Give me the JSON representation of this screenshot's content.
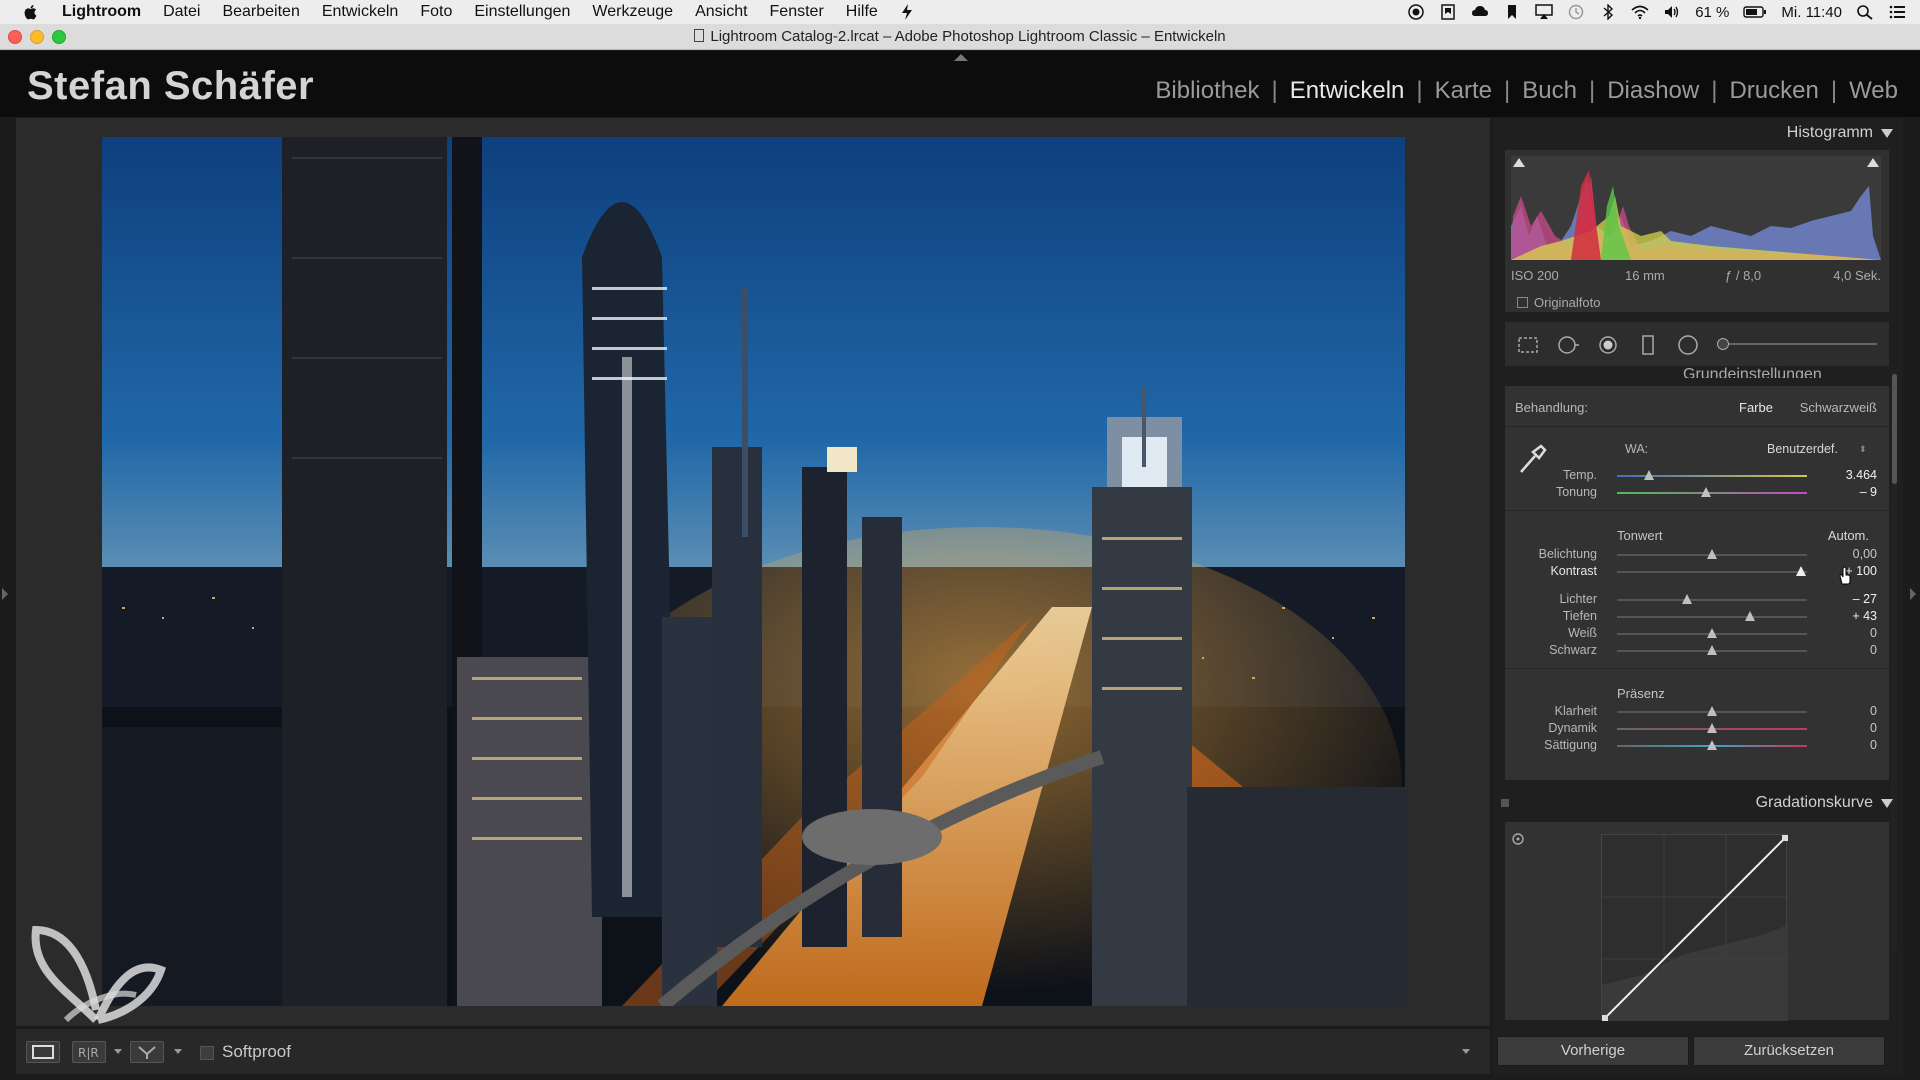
{
  "menubar": {
    "app_name": "Lightroom",
    "items": [
      "Datei",
      "Bearbeiten",
      "Entwickeln",
      "Foto",
      "Einstellungen",
      "Werkzeuge",
      "Ansicht",
      "Fenster",
      "Hilfe"
    ],
    "battery": "61 %",
    "clock": "Mi. 11:40"
  },
  "window": {
    "title": "Lightroom Catalog-2.lrcat – Adobe Photoshop Lightroom Classic – Entwickeln"
  },
  "identity_plate": "Stefan Schäfer",
  "modules": [
    "Bibliothek",
    "Entwickeln",
    "Karte",
    "Buch",
    "Diashow",
    "Drucken",
    "Web"
  ],
  "active_module": "Entwickeln",
  "toolbar": {
    "softproof_label": "Softproof"
  },
  "histogram": {
    "title": "Histogramm",
    "iso": "ISO 200",
    "focal": "16 mm",
    "aperture": "ƒ / 8,0",
    "shutter": "4,0 Sek.",
    "original_photo": "Originalfoto"
  },
  "basic": {
    "panel_title": "Grundeinstellungen",
    "treatment_label": "Behandlung:",
    "treatment_color": "Farbe",
    "treatment_bw": "Schwarzweiß",
    "wb_label": "WA:",
    "wb_value": "Benutzerdef.",
    "tone_label": "Tonwert",
    "auto_label": "Autom.",
    "presence_label": "Präsenz",
    "sliders": {
      "temp": {
        "label": "Temp.",
        "value": "3.464",
        "pos": 0.17
      },
      "tint": {
        "label": "Tonung",
        "value": "– 9",
        "pos": 0.47
      },
      "exposure": {
        "label": "Belichtung",
        "value": "0,00",
        "pos": 0.5
      },
      "contrast": {
        "label": "Kontrast",
        "value": "+ 100",
        "pos": 0.97
      },
      "highlights": {
        "label": "Lichter",
        "value": "– 27",
        "pos": 0.37
      },
      "shadows": {
        "label": "Tiefen",
        "value": "+ 43",
        "pos": 0.7
      },
      "whites": {
        "label": "Weiß",
        "value": "0",
        "pos": 0.5
      },
      "blacks": {
        "label": "Schwarz",
        "value": "0",
        "pos": 0.5
      },
      "clarity": {
        "label": "Klarheit",
        "value": "0",
        "pos": 0.5
      },
      "vibrance": {
        "label": "Dynamik",
        "value": "0",
        "pos": 0.5
      },
      "saturation": {
        "label": "Sättigung",
        "value": "0",
        "pos": 0.5
      }
    }
  },
  "tone_curve": {
    "title": "Gradationskurve"
  },
  "buttons": {
    "previous": "Vorherige",
    "reset": "Zurücksetzen"
  },
  "colors": {
    "panel_bg": "#323232",
    "background": "#1c1c1c",
    "identity_bg": "#0c0c0c"
  }
}
